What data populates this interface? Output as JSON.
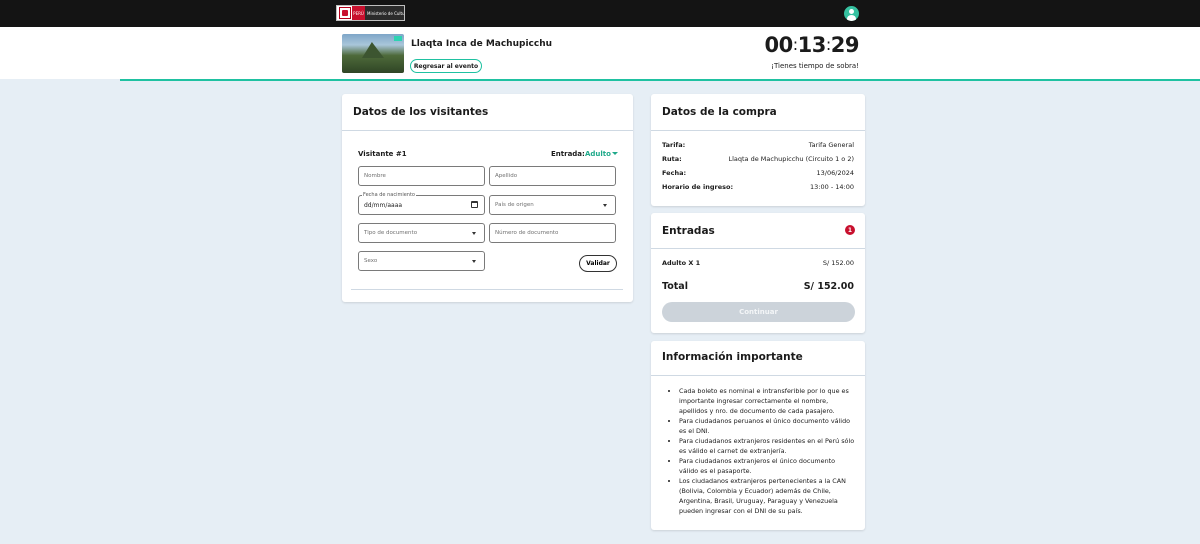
{
  "topbar": {
    "logo_peru": "PERÚ",
    "logo_ministry": "Ministerio de Cultura"
  },
  "event": {
    "title": "Llaqta Inca de Machupicchu",
    "back_label": "Regresar al evento"
  },
  "timer": {
    "hours": "00",
    "minutes": "13",
    "seconds": "29",
    "separator": ":",
    "message": "¡Tienes tiempo de sobra!"
  },
  "visitors": {
    "title": "Datos de los visitantes",
    "visitor_label": "Visitante #1",
    "entrada_label": "Entrada:",
    "entrada_value": "Adulto",
    "fields": {
      "nombre_placeholder": "Nombre",
      "apellido_placeholder": "Apellido",
      "fecha_label": "Fecha de nacimiento",
      "fecha_value": "dd/mm/aaaa",
      "pais_placeholder": "País de origen",
      "tipo_doc_placeholder": "Tipo de documento",
      "numero_doc_placeholder": "Número de documento",
      "sexo_placeholder": "Sexo"
    },
    "validate_label": "Validar"
  },
  "purchase": {
    "title": "Datos de la compra",
    "rows": [
      {
        "key": "Tarifa:",
        "value": "Tarifa General"
      },
      {
        "key": "Ruta:",
        "value": "Llaqta de Machupicchu (Circuito 1 o 2)"
      },
      {
        "key": "Fecha:",
        "value": "13/06/2024"
      },
      {
        "key": "Horario de ingreso:",
        "value": "13:00 - 14:00"
      }
    ]
  },
  "tickets": {
    "title": "Entradas",
    "badge": "1",
    "line_label": "Adulto X 1",
    "line_price": "S/ 152.00",
    "total_label": "Total",
    "total_value": "S/ 152.00",
    "continue_label": "Continuar"
  },
  "info": {
    "title": "Información importante",
    "items": [
      "Cada boleto es nominal e intransferible por lo que es importante ingresar correctamente el nombre, apellidos y nro. de documento de cada pasajero.",
      "Para ciudadanos peruanos el único documento válido es el DNI.",
      "Para ciudadanos extranjeros residentes en el Perú sólo es válido el carnet de extranjería.",
      "Para ciudadanos extranjeros el único documento válido es el pasaporte.",
      "Los ciudadanos extranjeros pertenecientes a la CAN (Bolivia, Colombia y Ecuador) además de Chile, Argentina, Brasil, Uruguay, Paraguay y Venezuela pueden ingresar con el DNI de su país."
    ]
  },
  "colors": {
    "accent": "#1fc1a1",
    "badge": "#c8102e",
    "background": "#e6eef5"
  }
}
